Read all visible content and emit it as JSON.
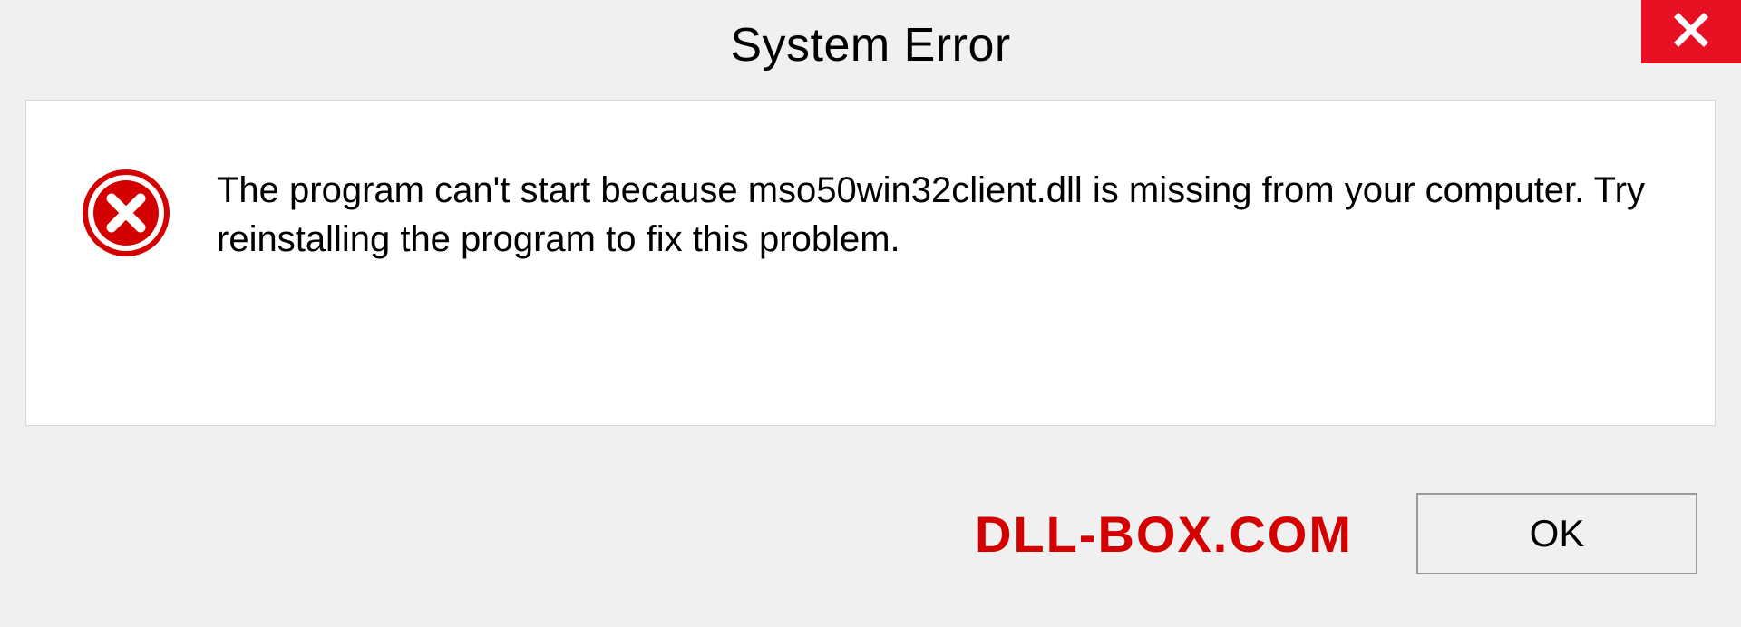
{
  "titlebar": {
    "title": "System Error"
  },
  "dialog": {
    "message": "The program can't start because mso50win32client.dll is missing from your computer. Try reinstalling the program to fix this problem."
  },
  "footer": {
    "watermark": "DLL-BOX.COM",
    "ok_label": "OK"
  }
}
